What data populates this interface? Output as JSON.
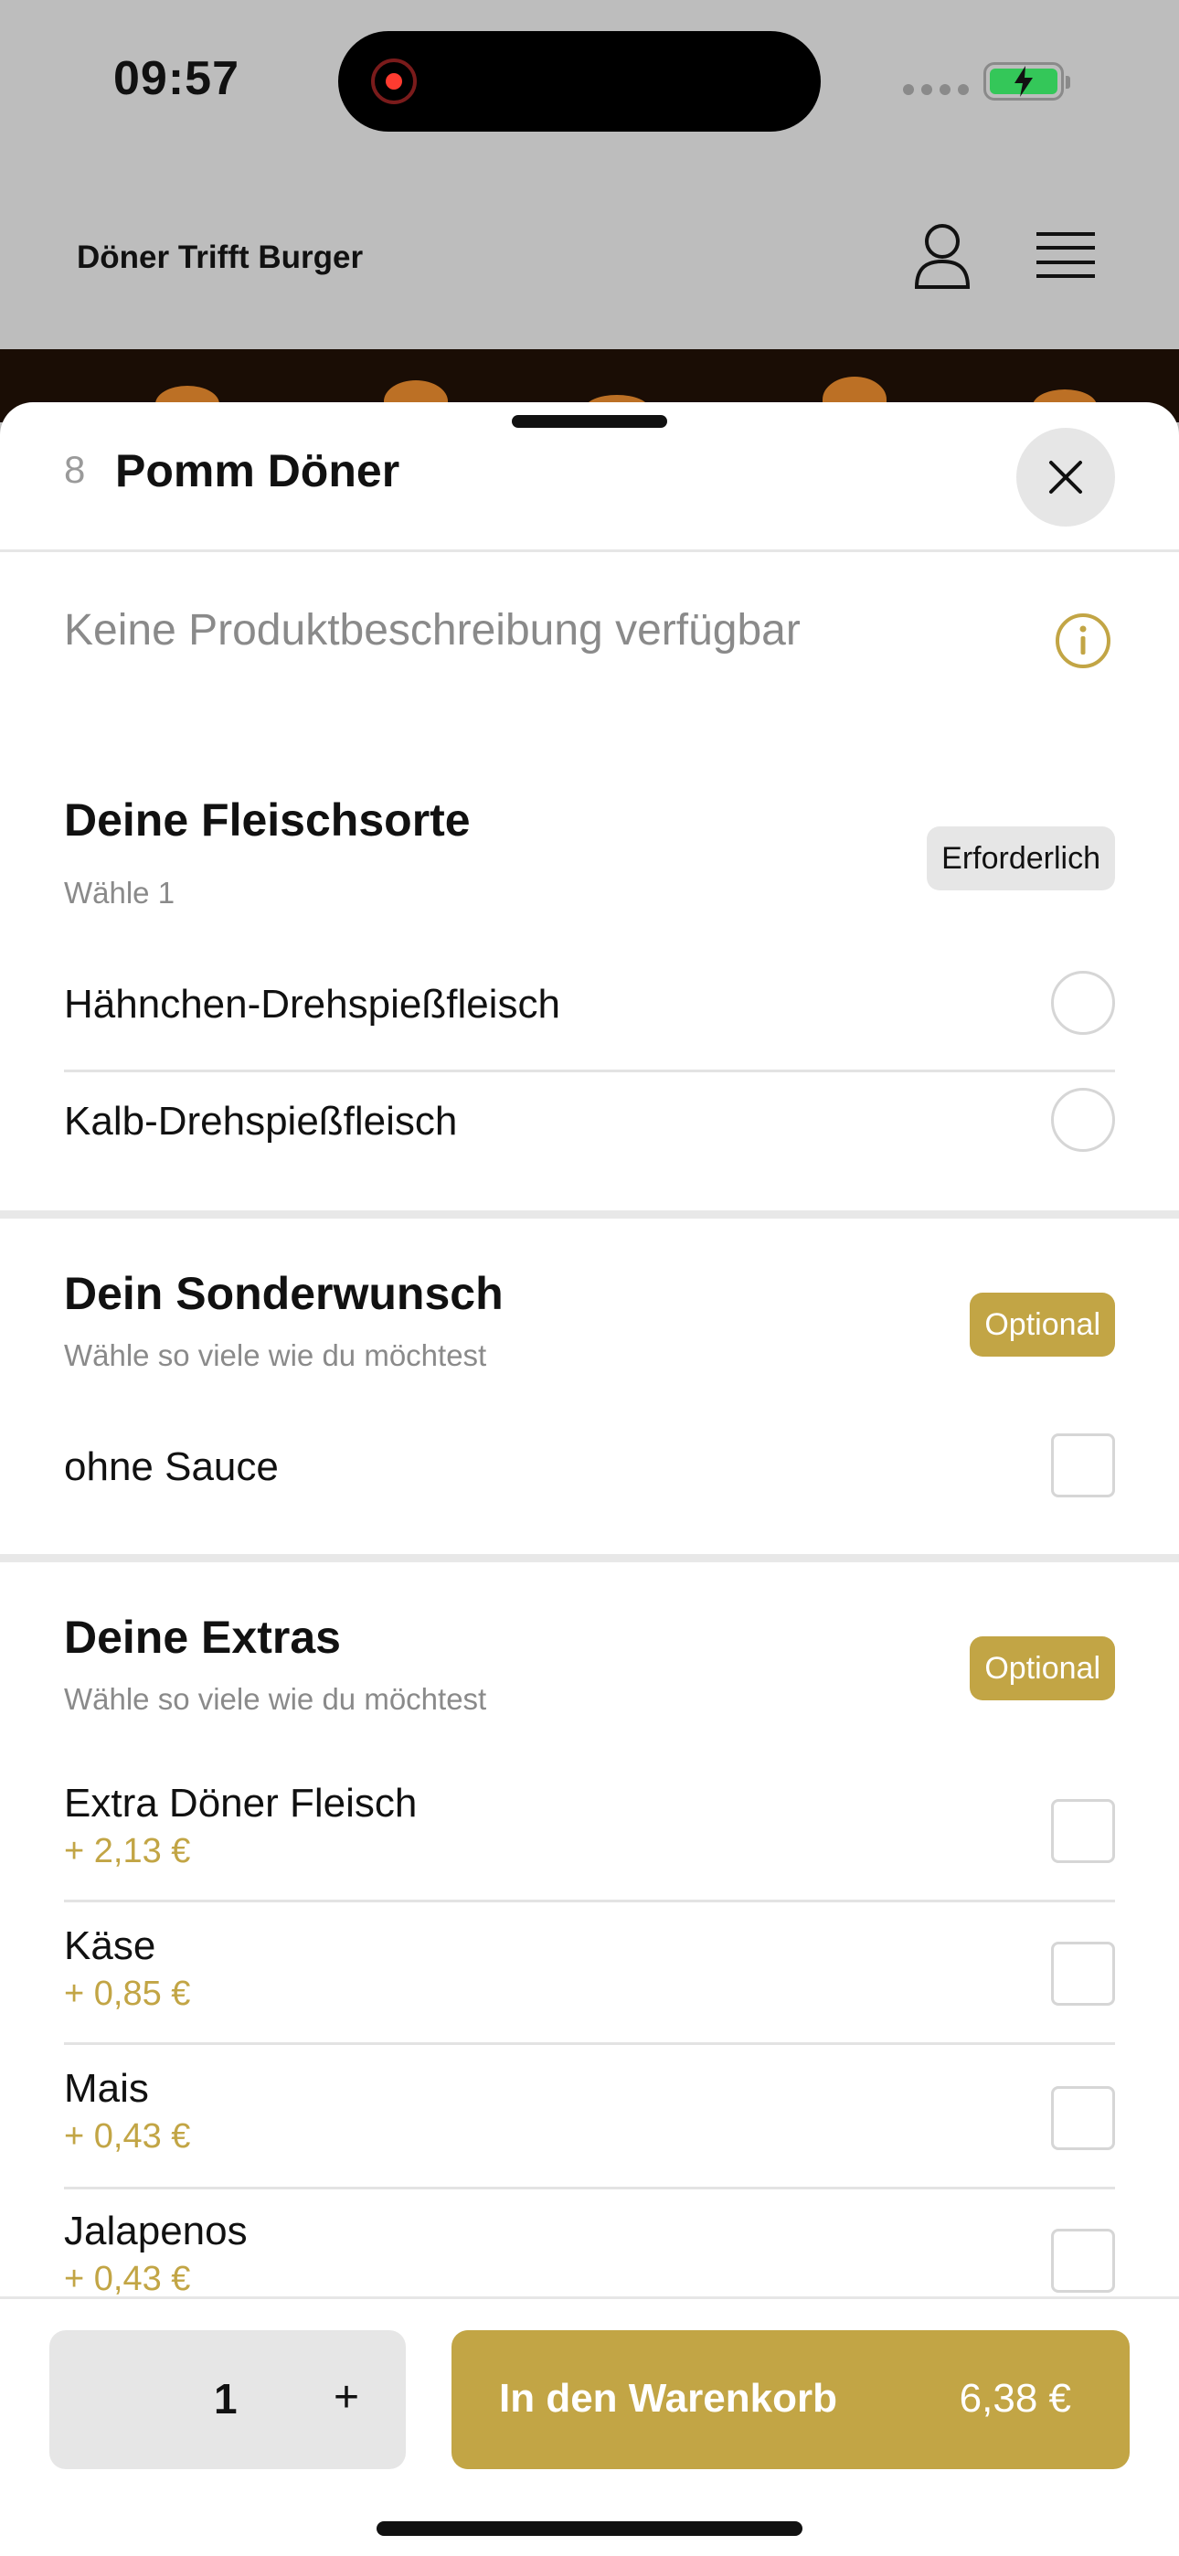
{
  "status_bar": {
    "time": "09:57"
  },
  "app_header": {
    "brand": "Döner Trifft Burger"
  },
  "product": {
    "number": "8",
    "title": "Pomm Döner",
    "description": "Keine Produktbeschreibung verfügbar"
  },
  "groups": [
    {
      "title": "Deine Fleischsorte",
      "subtitle": "Wähle 1",
      "badge": "Erforderlich",
      "options": [
        {
          "label": "Hähnchen-Drehspießfleisch"
        },
        {
          "label": "Kalb-Drehspießfleisch"
        }
      ]
    },
    {
      "title": "Dein Sonderwunsch",
      "subtitle": "Wähle so viele wie du möchtest",
      "badge": "Optional",
      "options": [
        {
          "label": "ohne Sauce"
        }
      ]
    },
    {
      "title": "Deine Extras",
      "subtitle": "Wähle so viele wie du möchtest",
      "badge": "Optional",
      "options": [
        {
          "label": "Extra Döner Fleisch",
          "price": "+ 2,13 €"
        },
        {
          "label": "Käse",
          "price": "+ 0,85 €"
        },
        {
          "label": "Mais",
          "price": "+ 0,43 €"
        },
        {
          "label": "Jalapenos",
          "price": "+ 0,43 €"
        }
      ]
    }
  ],
  "footer": {
    "quantity": "1",
    "plus": "+",
    "cart_label": "In den Warenkorb",
    "total": "6,38 €"
  },
  "colors": {
    "accent": "#c2a545",
    "required_badge": "#e6e6e6"
  },
  "icons": [
    "user-icon",
    "menu-icon",
    "close-icon",
    "info-icon"
  ]
}
